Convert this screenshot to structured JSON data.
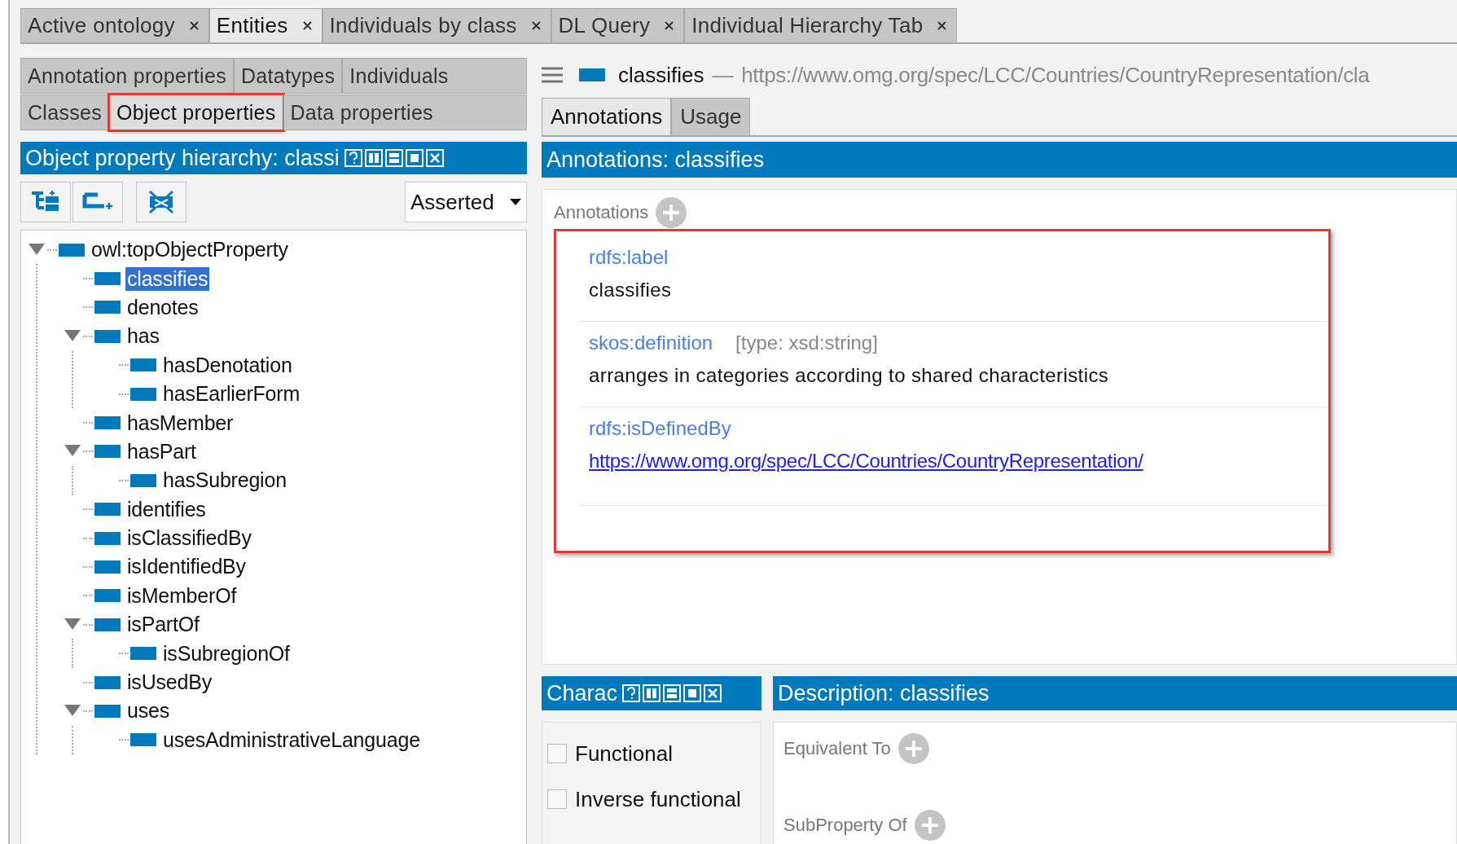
{
  "tabs": [
    {
      "label": "Active ontology",
      "selected": false
    },
    {
      "label": "Entities",
      "selected": true
    },
    {
      "label": "Individuals by class",
      "selected": false
    },
    {
      "label": "DL Query",
      "selected": false
    },
    {
      "label": "Individual Hierarchy Tab",
      "selected": false
    }
  ],
  "entity_tabs": [
    [
      {
        "label": "Annotation properties",
        "selected": false,
        "highlighted": false
      },
      {
        "label": "Datatypes",
        "selected": false,
        "highlighted": false
      },
      {
        "label": "Individuals",
        "selected": false,
        "highlighted": false
      }
    ],
    [
      {
        "label": "Classes",
        "selected": false,
        "highlighted": false
      },
      {
        "label": "Object properties",
        "selected": true,
        "highlighted": true
      },
      {
        "label": "Data properties",
        "selected": false,
        "highlighted": false
      }
    ]
  ],
  "hierarchy_panel": {
    "title": "Object property hierarchy: classi",
    "mode": "Asserted"
  },
  "tree": [
    {
      "label": "owl:topObjectProperty",
      "selected": false,
      "expanded": true,
      "children": [
        {
          "label": "classifies",
          "selected": true
        },
        {
          "label": "denotes",
          "selected": false
        },
        {
          "label": "has",
          "selected": false,
          "expanded": true,
          "children": [
            {
              "label": "hasDenotation",
              "selected": false
            },
            {
              "label": "hasEarlierForm",
              "selected": false
            }
          ]
        },
        {
          "label": "hasMember",
          "selected": false
        },
        {
          "label": "hasPart",
          "selected": false,
          "expanded": true,
          "children": [
            {
              "label": "hasSubregion",
              "selected": false
            }
          ]
        },
        {
          "label": "identifies",
          "selected": false
        },
        {
          "label": "isClassifiedBy",
          "selected": false
        },
        {
          "label": "isIdentifiedBy",
          "selected": false
        },
        {
          "label": "isMemberOf",
          "selected": false
        },
        {
          "label": "isPartOf",
          "selected": false,
          "expanded": true,
          "children": [
            {
              "label": "isSubregionOf",
              "selected": false
            }
          ]
        },
        {
          "label": "isUsedBy",
          "selected": false
        },
        {
          "label": "uses",
          "selected": false,
          "expanded": true,
          "children": [
            {
              "label": "usesAdministrativeLanguage",
              "selected": false
            }
          ]
        }
      ]
    }
  ],
  "entity_header": {
    "name": "classifies",
    "separator": "—",
    "iri": "https://www.omg.org/spec/LCC/Countries/CountryRepresentation/cla"
  },
  "view_tabs": [
    {
      "label": "Annotations",
      "selected": true
    },
    {
      "label": "Usage",
      "selected": false
    }
  ],
  "annotations_panel": {
    "title": "Annotations: classifies",
    "section_label": "Annotations",
    "highlighted": true,
    "items": [
      {
        "kind": "text",
        "property": "rdfs:label",
        "value": "classifies"
      },
      {
        "kind": "text",
        "property": "skos:definition",
        "type_note": "[type: xsd:string]",
        "value": "arranges in categories according to shared characteristics"
      },
      {
        "kind": "link",
        "property": "rdfs:isDefinedBy",
        "value": "https://www.omg.org/spec/LCC/Countries/CountryRepresentation/"
      }
    ]
  },
  "characteristics_panel": {
    "title": "Charac",
    "items": [
      {
        "label": "Functional",
        "checked": false
      },
      {
        "label": "Inverse functional",
        "checked": false
      }
    ]
  },
  "description_panel": {
    "title": "Description: classifies",
    "sections": [
      "Equivalent To",
      "SubProperty Of"
    ]
  }
}
